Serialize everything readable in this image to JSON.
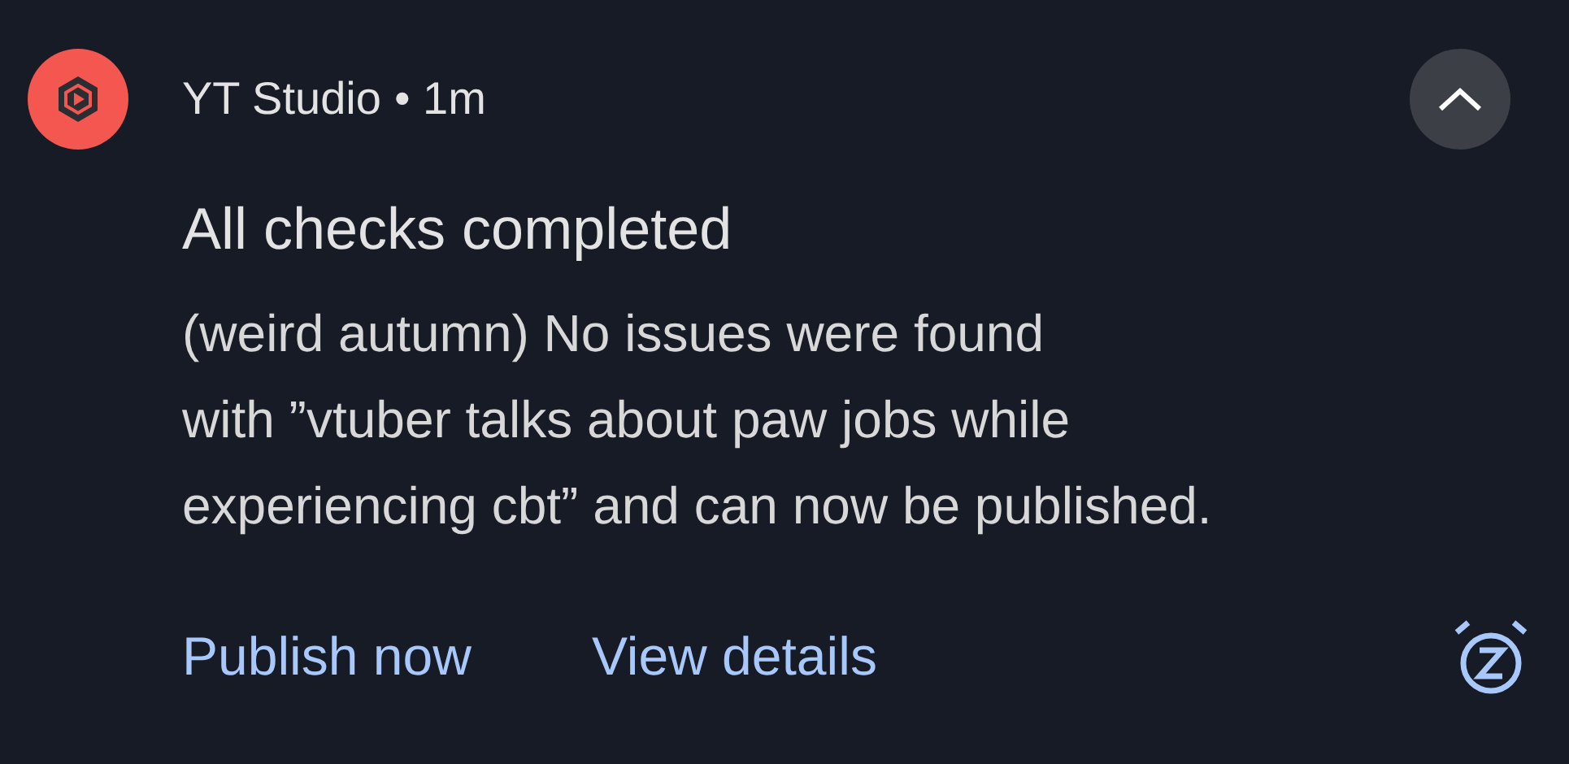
{
  "notification": {
    "app_name": "YT Studio",
    "time": "• 1m",
    "expanded": true,
    "title": "All checks completed",
    "body": "(weird autumn) No issues were found\nwith ”vtuber talks about paw jobs while\nexperiencing cbt” and can now be published.",
    "actions": [
      "Publish now",
      "View details"
    ]
  }
}
